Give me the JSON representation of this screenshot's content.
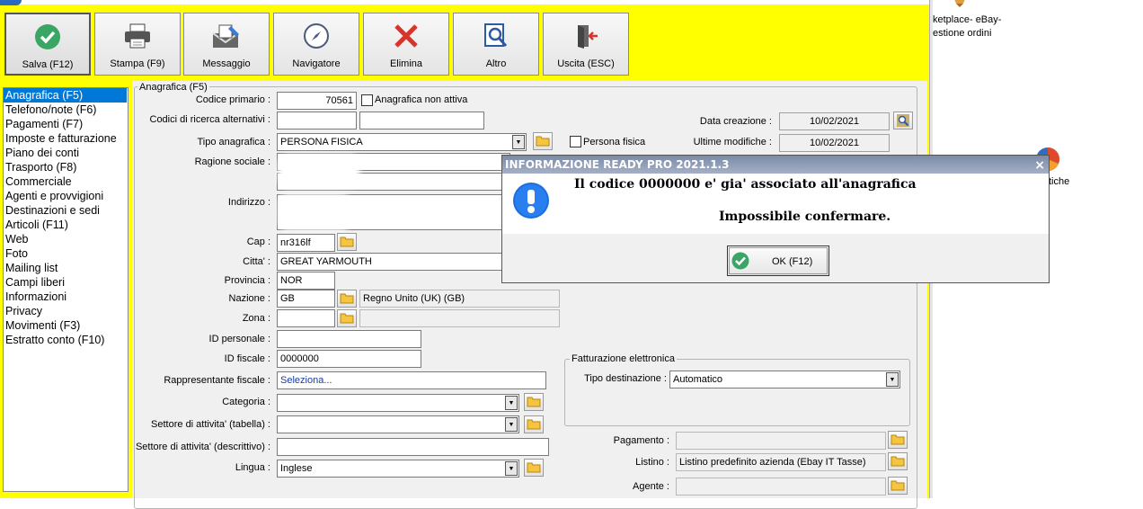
{
  "toolbar": {
    "buttons": [
      {
        "label": "Salva (F12)",
        "icon": "check-icon"
      },
      {
        "label": "Stampa (F9)",
        "icon": "printer-icon"
      },
      {
        "label": "Messaggio",
        "icon": "message-icon"
      },
      {
        "label": "Navigatore",
        "icon": "compass-icon"
      },
      {
        "label": "Elimina",
        "icon": "delete-icon"
      },
      {
        "label": "Altro",
        "icon": "search-doc-icon"
      },
      {
        "label": "Uscita (ESC)",
        "icon": "exit-icon"
      }
    ]
  },
  "sidebar": {
    "items": [
      {
        "label": "Anagrafica (F5)"
      },
      {
        "label": "Telefono/note (F6)"
      },
      {
        "label": "Pagamenti (F7)"
      },
      {
        "label": "Imposte e fatturazione"
      },
      {
        "label": "Piano dei conti"
      },
      {
        "label": "Trasporto (F8)"
      },
      {
        "label": "Commerciale"
      },
      {
        "label": "Agenti e provvigioni"
      },
      {
        "label": "Destinazioni e sedi"
      },
      {
        "label": "Articoli (F11)"
      },
      {
        "label": "Web"
      },
      {
        "label": "Foto"
      },
      {
        "label": "Mailing list"
      },
      {
        "label": "Campi liberi"
      },
      {
        "label": "Informazioni"
      },
      {
        "label": "Privacy"
      },
      {
        "label": "Movimenti (F3)"
      },
      {
        "label": "Estratto conto (F10)"
      }
    ],
    "active_index": 0
  },
  "form": {
    "group_title": "Anagrafica (F5)",
    "codice_primario": {
      "label": "Codice primario :",
      "value": "70561"
    },
    "non_attiva": {
      "label": "Anagrafica non attiva",
      "checked": false
    },
    "codici_alt": {
      "label": "Codici di ricerca alternativi :",
      "value1": "",
      "value2": ""
    },
    "data_creazione": {
      "label": "Data creazione :",
      "value": "10/02/2021"
    },
    "ultime_modifiche": {
      "label": "Ultime modifiche :",
      "value": "10/02/2021"
    },
    "tipo_anagrafica": {
      "label": "Tipo anagrafica :",
      "value": "PERSONA FISICA"
    },
    "persona_fisica": {
      "label": "Persona fisica",
      "checked": false
    },
    "ragione_sociale": {
      "label": "Ragione sociale :"
    },
    "indirizzo": {
      "label": "Indirizzo :"
    },
    "cap": {
      "label": "Cap :",
      "value": "nr316lf"
    },
    "citta": {
      "label": "Citta' :",
      "value": "GREAT YARMOUTH"
    },
    "provincia": {
      "label": "Provincia :",
      "value": "NOR"
    },
    "nazione": {
      "label": "Nazione :",
      "code": "GB",
      "description": "Regno Unito (UK) (GB)"
    },
    "zona": {
      "label": "Zona :",
      "code": "",
      "description": ""
    },
    "id_personale": {
      "label": "ID personale :",
      "value": ""
    },
    "id_fiscale": {
      "label": "ID fiscale :",
      "value": "0000000"
    },
    "rappresentante": {
      "label": "Rappresentante fiscale :",
      "value": "Seleziona..."
    },
    "categoria": {
      "label": "Categoria :",
      "value": ""
    },
    "settore_tab": {
      "label": "Settore di attivita' (tabella) :",
      "value": ""
    },
    "settore_desc": {
      "label": "Settore di attivita' (descrittivo) :",
      "value": ""
    },
    "lingua": {
      "label": "Lingua :",
      "value": "Inglese"
    },
    "fattura_group": "Fatturazione elettronica",
    "tipo_destinazione": {
      "label": "Tipo destinazione :",
      "value": "Automatico"
    },
    "pagamento": {
      "label": "Pagamento :",
      "value": ""
    },
    "listino": {
      "label": "Listino :",
      "value": "Listino predefinito azienda (Ebay IT Tasse)"
    },
    "agente": {
      "label": "Agente :",
      "value": ""
    }
  },
  "right_panel": {
    "line1": "ketplace- eBay-",
    "line2": "estione ordini",
    "line3": "tiche"
  },
  "dialog": {
    "title": "INFORMAZIONE READY PRO 2021.1.3",
    "message1": "Il codice 0000000 e' gia' associato all'anagrafica",
    "message2": "Impossibile confermare.",
    "ok_label": "OK (F12)",
    "close": "×"
  },
  "colors": {
    "background": "#ffff00",
    "selection": "#0078d7",
    "dialog_title": "#7b8ba8",
    "save_green": "#3aa564",
    "delete_red": "#d9342b",
    "folder_yellow": "#f5c542"
  }
}
